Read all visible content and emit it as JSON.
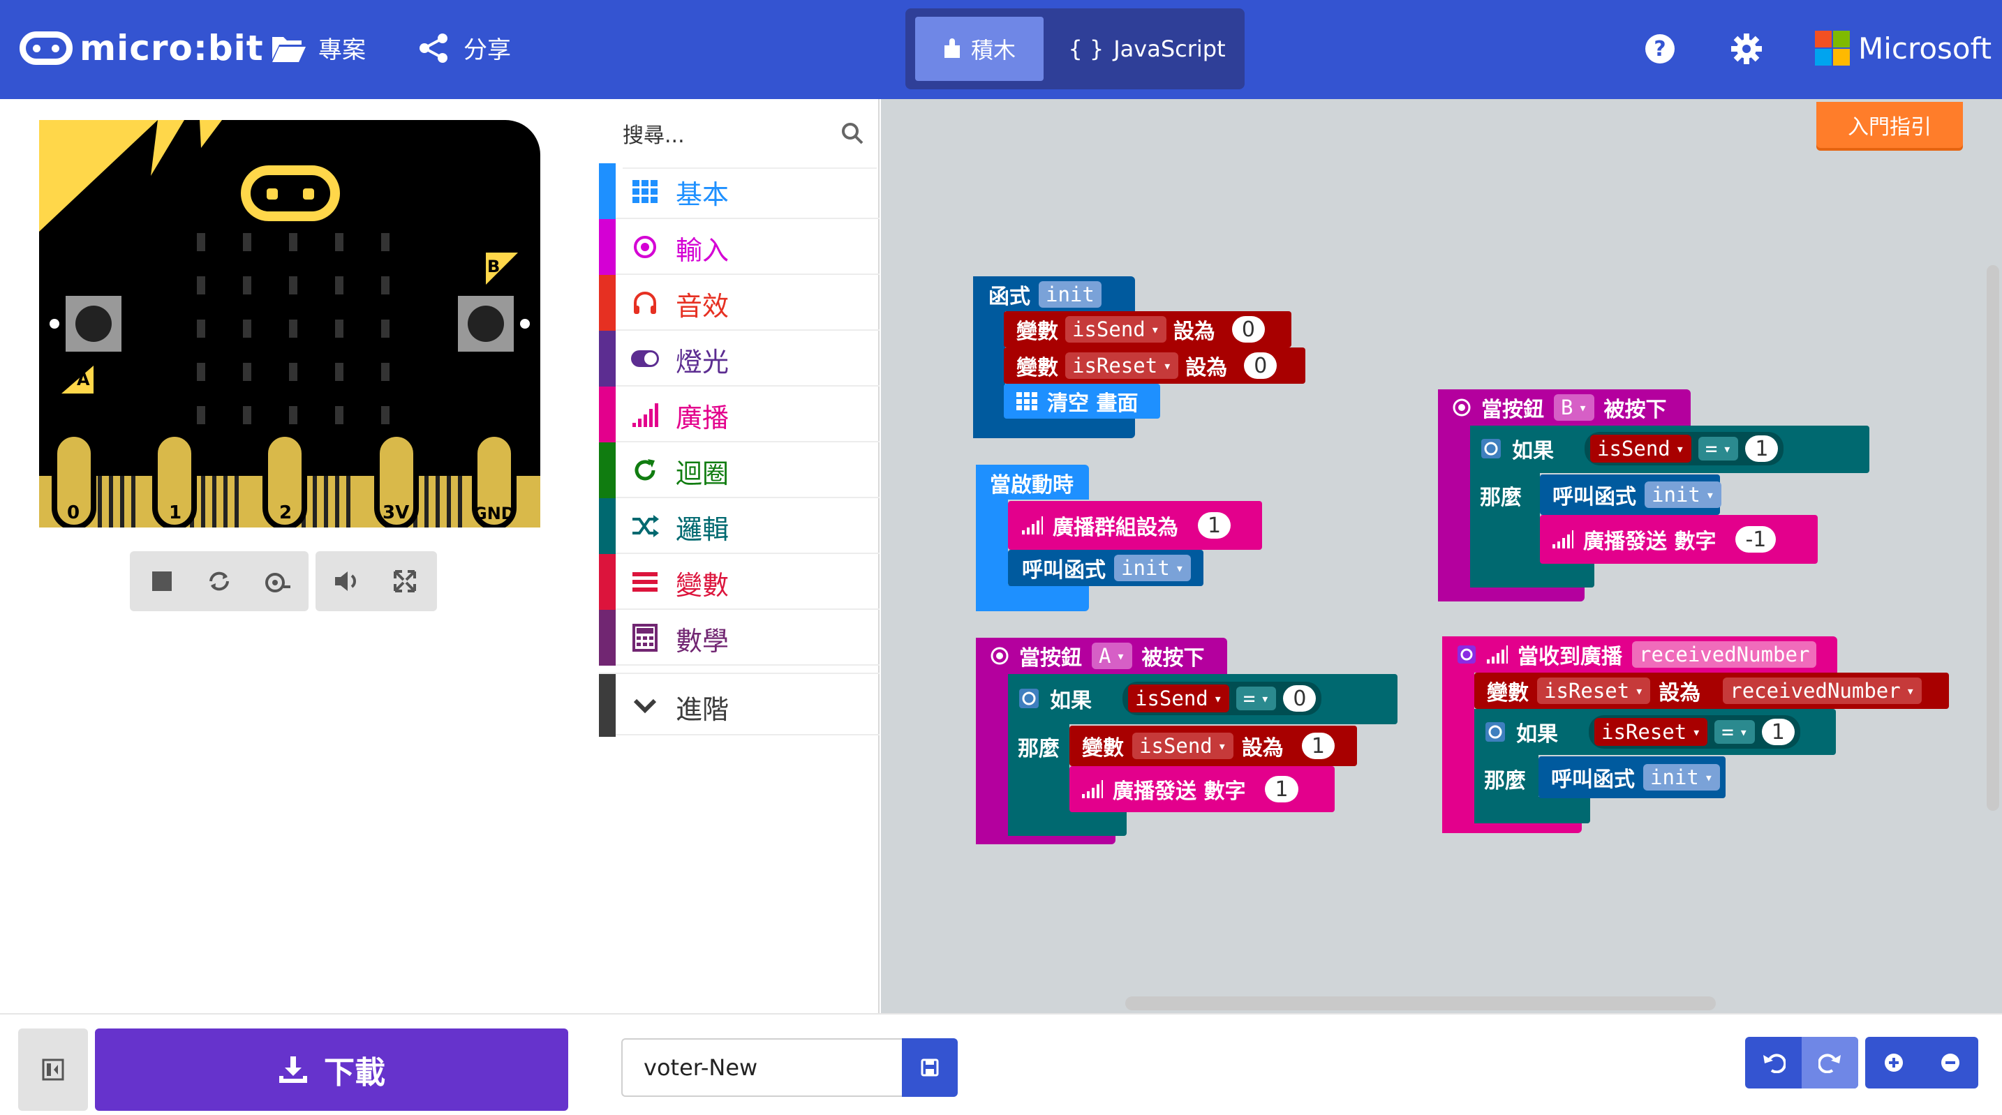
{
  "header": {
    "logo_text": "micro:bit",
    "projects_label": "專案",
    "share_label": "分享",
    "blocks_tab": "積木",
    "js_tab": "JavaScript",
    "js_tab_glyph": "{ }",
    "microsoft_label": "Microsoft"
  },
  "simulator": {
    "pins": [
      "0",
      "1",
      "2",
      "3V",
      "GND"
    ],
    "button_a": "A",
    "button_b": "B"
  },
  "toolbox": {
    "search_placeholder": "搜尋...",
    "categories": [
      {
        "label": "基本",
        "color": "#1e90ff"
      },
      {
        "label": "輸入",
        "color": "#d400d4"
      },
      {
        "label": "音效",
        "color": "#e63022"
      },
      {
        "label": "燈光",
        "color": "#5c2d91"
      },
      {
        "label": "廣播",
        "color": "#e3008c"
      },
      {
        "label": "迴圈",
        "color": "#107c10"
      },
      {
        "label": "邏輯",
        "color": "#006970"
      },
      {
        "label": "變數",
        "color": "#dc143c"
      },
      {
        "label": "數學",
        "color": "#712672"
      },
      {
        "label": "進階",
        "color": "#3c3c3c"
      }
    ]
  },
  "workspace": {
    "getting_started": "入門指引",
    "blocks": {
      "func_header": "函式",
      "func_name": "init",
      "var_kw": "變數",
      "set_to": "設為",
      "isSend": "isSend",
      "isReset": "isReset",
      "zero": "0",
      "one": "1",
      "minus_one": "-1",
      "clear_screen": "清空 畫面",
      "on_start": "當啟動時",
      "radio_set_group": "廣播群組設為",
      "call_func": "呼叫函式",
      "on_button": "當按鈕",
      "pressed": "被按下",
      "btn_a": "A",
      "btn_b": "B",
      "if_kw": "如果",
      "then_kw": "那麼",
      "eq": "=",
      "radio_send_number": "廣播發送 數字",
      "on_received": "當收到廣播",
      "receivedNumber": "receivedNumber"
    }
  },
  "bottom": {
    "download_label": "下載",
    "project_name": "voter-New"
  },
  "colors": {
    "header": "#3454d1",
    "functions": "#005a9e",
    "variables": "#a80000",
    "logic": "#006970",
    "radio": "#e3008c",
    "input": "#b4009e",
    "basic": "#1e90ff",
    "download": "#6633cc"
  }
}
